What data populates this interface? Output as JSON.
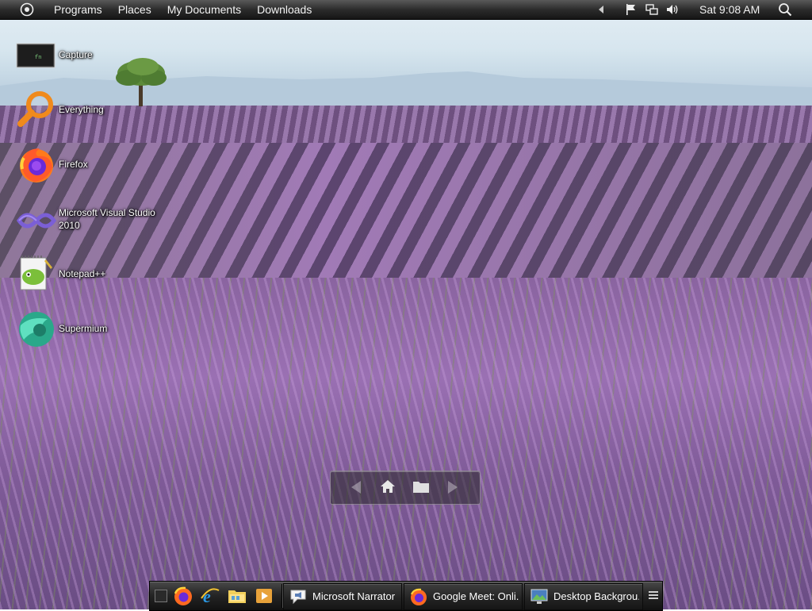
{
  "top_bar": {
    "menu": [
      "Programs",
      "Places",
      "My Documents",
      "Downloads"
    ],
    "clock": "Sat 9:08 AM"
  },
  "desktop_icons": [
    {
      "label": "Capture",
      "icon": "capture-terminal-icon"
    },
    {
      "label": "Everything",
      "icon": "magnifier-icon"
    },
    {
      "label": "Firefox",
      "icon": "firefox-icon"
    },
    {
      "label": "Microsoft Visual Studio 2010",
      "label_lines": [
        "Microsoft Visual Studio",
        "2010"
      ],
      "icon": "visual-studio-icon"
    },
    {
      "label": "Notepad++",
      "icon": "notepad-plus-plus-icon"
    },
    {
      "label": "Supermium",
      "icon": "supermium-icon"
    }
  ],
  "taskbar": {
    "quick_launch": [
      "firefox-icon",
      "internet-explorer-icon",
      "file-explorer-icon",
      "media-player-icon"
    ],
    "tasks": [
      {
        "label": "Microsoft Narrator",
        "icon": "narrator-icon"
      },
      {
        "label": "Google Meet: Onli...",
        "icon": "firefox-icon"
      },
      {
        "label": "Desktop Backgrou...",
        "icon": "display-settings-icon"
      }
    ]
  },
  "colors": {
    "topbar": "#1e1e1e",
    "taskbar": "#262626",
    "lavender": "#9a70b3",
    "sky": "#d7e6ef"
  }
}
